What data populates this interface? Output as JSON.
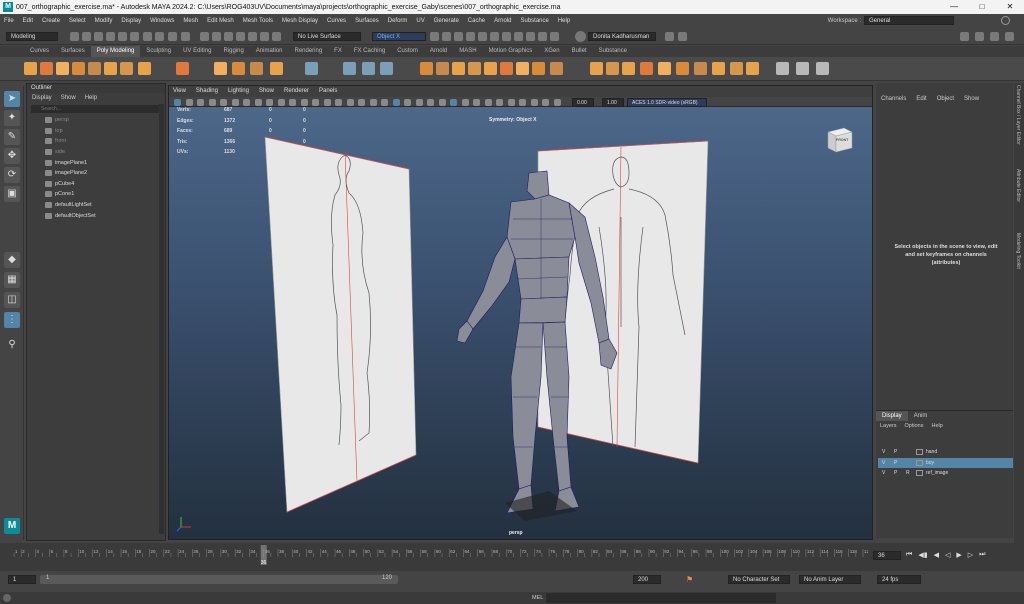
{
  "titlebar": {
    "title": "007_orthographic_exercise.ma* - Autodesk MAYA 2024.2: C:\\Users\\ROG403UV\\Documents\\maya\\projects\\orthographic_exercise_Gaby\\scenes\\007_orthographic_exercise.ma",
    "logo_letter": "M"
  },
  "menubar": {
    "items": [
      "File",
      "Edit",
      "Create",
      "Select",
      "Modify",
      "Display",
      "Windows",
      "Mesh",
      "Edit Mesh",
      "Mesh Tools",
      "Mesh Display",
      "Curves",
      "Surfaces",
      "Deform",
      "UV",
      "Generate",
      "Cache",
      "Arnold",
      "Substance",
      "Help"
    ],
    "workspace_label": "Workspace :",
    "workspace_value": "General"
  },
  "statusline": {
    "mode": "Modeling",
    "live_surface": "No Live Surface",
    "symmetry": "Object X",
    "user": "Donita Kadharusman"
  },
  "shelf": {
    "tabs": [
      "Curves",
      "Surfaces",
      "Poly Modeling",
      "Sculpting",
      "UV Editing",
      "Rigging",
      "Animation",
      "Rendering",
      "FX",
      "FX Caching",
      "Custom",
      "Arnold",
      "MASH",
      "Motion Graphics",
      "XGen",
      "Bullet",
      "Substance"
    ],
    "active": "Poly Modeling"
  },
  "outliner": {
    "title": "Outliner",
    "menu": [
      "Display",
      "Show",
      "Help"
    ],
    "search_placeholder": "Search...",
    "items": [
      {
        "name": "persp",
        "dim": true
      },
      {
        "name": "top",
        "dim": true
      },
      {
        "name": "front",
        "dim": true
      },
      {
        "name": "side",
        "dim": true
      },
      {
        "name": "imagePlane1",
        "dim": false
      },
      {
        "name": "imagePlane2",
        "dim": false
      },
      {
        "name": "pCube4",
        "dim": false
      },
      {
        "name": "pCone1",
        "dim": false
      },
      {
        "name": "defaultLightSet",
        "dim": false
      },
      {
        "name": "defaultObjectSet",
        "dim": false
      }
    ]
  },
  "viewport": {
    "menu": [
      "View",
      "Shading",
      "Lighting",
      "Show",
      "Renderer",
      "Panels"
    ],
    "exposure": "0.00",
    "gamma": "1.00",
    "colorspace": "ACES 1.0 SDR-video (sRGB)",
    "symmetry_label": "Symmetry: Object X",
    "camera": "persp",
    "viewcube_label": "FRONT",
    "hud": [
      {
        "label": "Verts:",
        "v1": "687",
        "v2": "0",
        "v3": "0"
      },
      {
        "label": "Edges:",
        "v1": "1372",
        "v2": "0",
        "v3": "0"
      },
      {
        "label": "Faces:",
        "v1": "689",
        "v2": "0",
        "v3": "0"
      },
      {
        "label": "Tris:",
        "v1": "1366",
        "v2": "0",
        "v3": "0"
      },
      {
        "label": "UVs:",
        "v1": "1130",
        "v2": "0",
        "v3": "0"
      }
    ]
  },
  "channelbox": {
    "menu": [
      "Channels",
      "Edit",
      "Object",
      "Show"
    ],
    "hint": "Select objects in the scene to view, edit and set keyframes on channels (attributes)"
  },
  "layers": {
    "tabs": [
      "Display",
      "Anim"
    ],
    "menu": [
      "Layers",
      "Options",
      "Help"
    ],
    "rows": [
      {
        "v": "V",
        "p": "P",
        "r": "",
        "name": "hand",
        "selected": false
      },
      {
        "v": "V",
        "p": "P",
        "r": "",
        "name": "boy",
        "selected": true
      },
      {
        "v": "V",
        "p": "P",
        "r": "R",
        "name": "ref_image",
        "selected": false
      }
    ]
  },
  "side_tabs": [
    "Channel Box / Layer Editor",
    "Attribute Editor",
    "Modeling Toolkit"
  ],
  "timeslider": {
    "ticks": [
      "1",
      "2",
      "4",
      "6",
      "8",
      "10",
      "12",
      "14",
      "16",
      "18",
      "20",
      "22",
      "24",
      "26",
      "28",
      "30",
      "32",
      "34",
      "36",
      "38",
      "40",
      "42",
      "44",
      "46",
      "48",
      "50",
      "52",
      "54",
      "56",
      "58",
      "60",
      "62",
      "64",
      "66",
      "68",
      "70",
      "72",
      "74",
      "76",
      "78",
      "80",
      "82",
      "84",
      "86",
      "88",
      "90",
      "92",
      "94",
      "96",
      "98",
      "100",
      "102",
      "104",
      "106",
      "108",
      "110",
      "112",
      "114",
      "116",
      "118",
      "120"
    ],
    "current_frame": "36",
    "current_frame_field": "36"
  },
  "rangeslider": {
    "start": "1",
    "range_start": "1",
    "range_end": "120",
    "end": "200",
    "char_set": "No Character Set",
    "anim_layer": "No Anim Layer",
    "fps": "24 fps"
  },
  "cmdline": {
    "label": "MEL"
  },
  "colors": {
    "accent": "#e8a24a",
    "selection": "#5285a6",
    "cube": "#4a4e5a",
    "wire": "#1d1d66"
  }
}
